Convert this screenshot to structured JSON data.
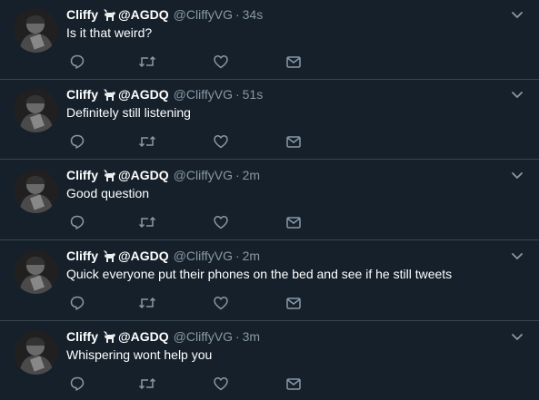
{
  "colors": {
    "background": "#15202b",
    "divider": "#38444d",
    "primary_text": "#ffffff",
    "secondary_text": "#8899a6"
  },
  "icons": {
    "reply": "speech-bubble-icon",
    "retweet": "retweet-arrows-icon",
    "like": "heart-outline-icon",
    "share": "envelope-icon",
    "menu": "chevron-down-icon",
    "emoji": "goat-emoji-icon"
  },
  "tweets": [
    {
      "name_before": "Cliffy ",
      "name_after": "@AGDQ",
      "handle": "@CliffyVG",
      "separator": "·",
      "time": "34s",
      "text": "Is it that weird?"
    },
    {
      "name_before": "Cliffy ",
      "name_after": "@AGDQ",
      "handle": "@CliffyVG",
      "separator": "·",
      "time": "51s",
      "text": "Definitely still listening"
    },
    {
      "name_before": "Cliffy ",
      "name_after": "@AGDQ",
      "handle": "@CliffyVG",
      "separator": "·",
      "time": "2m",
      "text": "Good question"
    },
    {
      "name_before": "Cliffy ",
      "name_after": "@AGDQ",
      "handle": "@CliffyVG",
      "separator": "·",
      "time": "2m",
      "text": "Quick everyone put their phones on the bed and see if he still tweets"
    },
    {
      "name_before": "Cliffy ",
      "name_after": "@AGDQ",
      "handle": "@CliffyVG",
      "separator": "·",
      "time": "3m",
      "text": "Whispering wont help you"
    }
  ]
}
